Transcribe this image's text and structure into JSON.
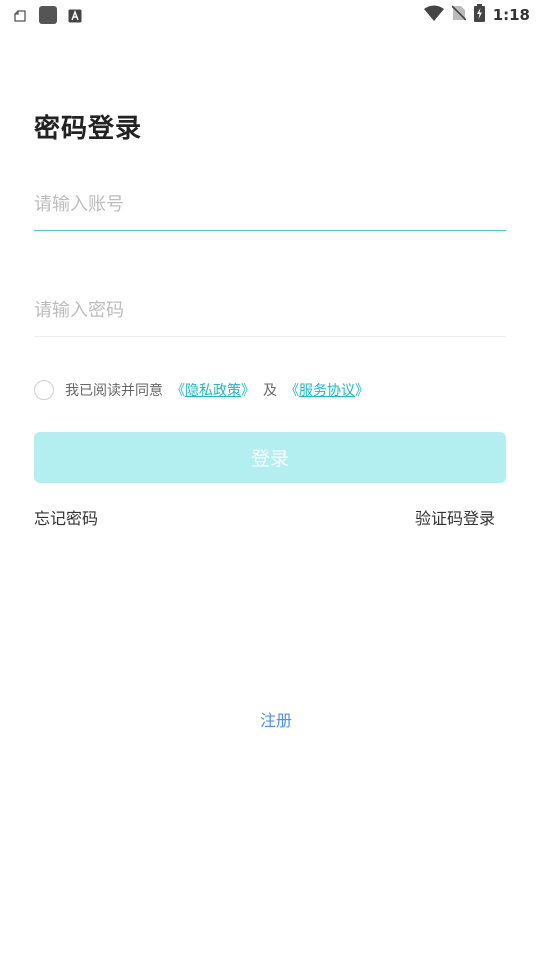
{
  "status_bar": {
    "time": "1:18",
    "left_icons": [
      "cloud-outline-icon",
      "app-square-icon",
      "a-badge-icon"
    ],
    "right_icons": [
      "wifi-icon",
      "no-sim-icon",
      "battery-charging-icon"
    ]
  },
  "login": {
    "title": "密码登录",
    "account_placeholder": "请输入账号",
    "account_value": "",
    "password_placeholder": "请输入密码",
    "password_value": "",
    "agreement": {
      "checked": false,
      "prefix": "我已阅读并同意",
      "privacy_open": "《",
      "privacy_label": "隐私政策",
      "privacy_close": "》",
      "and": "及",
      "service_open": "《",
      "service_label": "服务协议",
      "service_close": "》"
    },
    "login_button": "登录",
    "forgot_password": "忘记密码",
    "code_login": "验证码登录",
    "register": "注册"
  },
  "colors": {
    "accent": "#4ec9d2",
    "link": "#1fb9c6",
    "button_disabled": "#b3eff0",
    "register_link": "#4f8ff0"
  }
}
